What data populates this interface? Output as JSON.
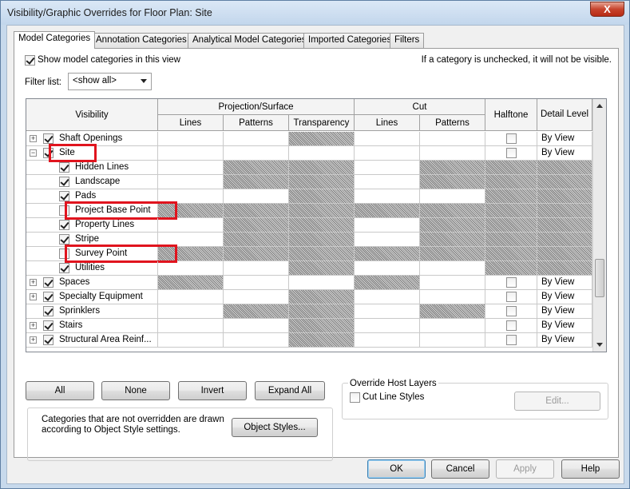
{
  "window": {
    "title": "Visibility/Graphic Overrides for Floor Plan: Site",
    "close_label": "X"
  },
  "tabs": [
    {
      "label": "Model Categories",
      "active": true
    },
    {
      "label": "Annotation Categories"
    },
    {
      "label": "Analytical Model Categories"
    },
    {
      "label": "Imported Categories"
    },
    {
      "label": "Filters"
    }
  ],
  "options": {
    "show_model_categories_label": "Show model categories in this view",
    "show_model_categories_checked": true,
    "unchecked_note": "If a category is unchecked, it will not be visible.",
    "filter_list_label": "Filter list:",
    "filter_list_value": "<show all>"
  },
  "grid": {
    "headers": {
      "visibility": "Visibility",
      "projection_surface": "Projection/Surface",
      "cut": "Cut",
      "lines": "Lines",
      "patterns": "Patterns",
      "transparency": "Transparency",
      "cut_lines": "Lines",
      "cut_patterns": "Patterns",
      "halftone": "Halftone",
      "detail_level": "Detail Level"
    },
    "rows": [
      {
        "name": "Shaft Openings",
        "level": 0,
        "expander": "+",
        "checked": true,
        "detail": "By View",
        "halftone": true,
        "hatch": [
          false,
          false,
          true,
          false,
          false,
          false
        ]
      },
      {
        "name": "Site",
        "level": 0,
        "expander": "−",
        "checked": true,
        "detail": "By View",
        "halftone": true,
        "hatch": [
          false,
          false,
          false,
          false,
          false,
          false
        ],
        "highlight": true
      },
      {
        "name": "Hidden Lines",
        "level": 1,
        "checked": true,
        "detail": "",
        "halftone": false,
        "hatch": [
          false,
          true,
          true,
          false,
          true,
          true
        ]
      },
      {
        "name": "Landscape",
        "level": 1,
        "checked": true,
        "detail": "",
        "halftone": false,
        "hatch": [
          false,
          true,
          true,
          false,
          true,
          true
        ]
      },
      {
        "name": "Pads",
        "level": 1,
        "checked": true,
        "detail": "",
        "halftone": false,
        "hatch": [
          false,
          false,
          true,
          false,
          false,
          true
        ]
      },
      {
        "name": "Project Base Point",
        "level": 1,
        "checked": false,
        "detail": "",
        "halftone": false,
        "hatch": [
          true,
          true,
          true,
          true,
          true,
          true
        ],
        "highlight": true
      },
      {
        "name": "Property Lines",
        "level": 1,
        "checked": true,
        "detail": "",
        "halftone": false,
        "hatch": [
          false,
          true,
          true,
          false,
          true,
          true
        ]
      },
      {
        "name": "Stripe",
        "level": 1,
        "checked": true,
        "detail": "",
        "halftone": false,
        "hatch": [
          false,
          true,
          true,
          false,
          true,
          true
        ]
      },
      {
        "name": "Survey Point",
        "level": 1,
        "checked": false,
        "detail": "",
        "halftone": false,
        "hatch": [
          true,
          true,
          true,
          true,
          true,
          true
        ],
        "highlight": true
      },
      {
        "name": "Utilities",
        "level": 1,
        "checked": true,
        "detail": "",
        "halftone": false,
        "hatch": [
          false,
          false,
          true,
          false,
          false,
          true
        ]
      },
      {
        "name": "Spaces",
        "level": 0,
        "expander": "+",
        "checked": true,
        "detail": "By View",
        "halftone": true,
        "hatch": [
          true,
          false,
          false,
          true,
          false,
          false
        ]
      },
      {
        "name": "Specialty Equipment",
        "level": 0,
        "expander": "+",
        "checked": true,
        "detail": "By View",
        "halftone": true,
        "hatch": [
          false,
          false,
          true,
          false,
          false,
          false
        ]
      },
      {
        "name": "Sprinklers",
        "level": 0,
        "checked": true,
        "detail": "By View",
        "halftone": true,
        "hatch": [
          false,
          true,
          true,
          false,
          true,
          false
        ]
      },
      {
        "name": "Stairs",
        "level": 0,
        "expander": "+",
        "checked": true,
        "detail": "By View",
        "halftone": true,
        "hatch": [
          false,
          false,
          true,
          false,
          false,
          false
        ]
      },
      {
        "name": "Structural Area Reinf...",
        "level": 0,
        "expander": "+",
        "checked": true,
        "detail": "By View",
        "halftone": true,
        "hatch": [
          false,
          false,
          true,
          false,
          false,
          false
        ]
      }
    ]
  },
  "buttons": {
    "all": "All",
    "none": "None",
    "invert": "Invert",
    "expand_all": "Expand All",
    "object_styles": "Object Styles...",
    "edit": "Edit...",
    "ok": "OK",
    "cancel": "Cancel",
    "apply": "Apply",
    "help": "Help"
  },
  "override_host": {
    "title": "Override Host Layers",
    "cut_line_styles": "Cut Line Styles",
    "cut_line_styles_checked": false
  },
  "info_text": "Categories that are not overridden are drawn according to Object Style settings."
}
